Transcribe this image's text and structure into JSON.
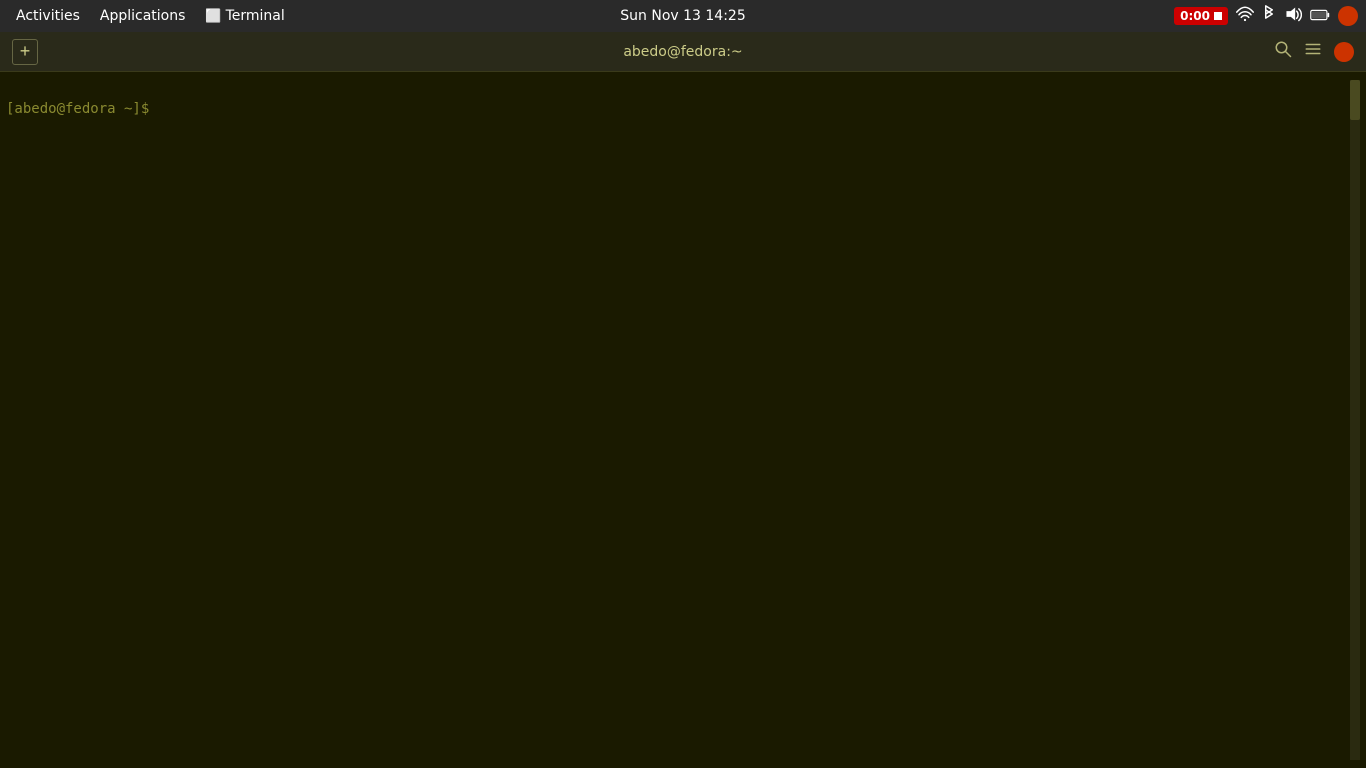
{
  "systembar": {
    "activities_label": "Activities",
    "applications_label": "Applications",
    "terminal_label": "Terminal",
    "datetime": "Sun Nov 13  14:25",
    "recording_time": "0:00",
    "wifi_icon": "wifi",
    "bluetooth_icon": "bluetooth",
    "volume_icon": "volume",
    "battery_icon": "battery",
    "user_icon": "user-circle"
  },
  "terminal": {
    "title": "abedo@fedora:~",
    "new_tab_icon": "+",
    "search_icon": "search",
    "menu_icon": "menu",
    "user_circle_icon": "circle",
    "prompt": "[abedo@fedora ~]$"
  }
}
